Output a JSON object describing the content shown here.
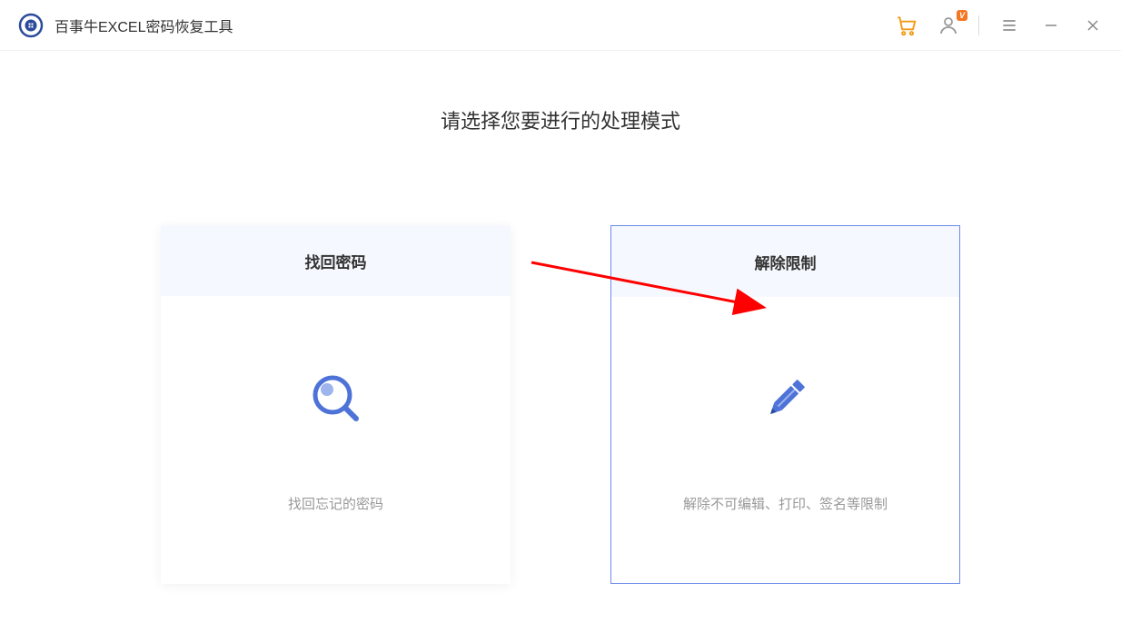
{
  "header": {
    "app_title": "百事牛EXCEL密码恢复工具",
    "profile_badge": "V"
  },
  "main": {
    "heading": "请选择您要进行的处理模式",
    "cards": [
      {
        "title": "找回密码",
        "desc": "找回忘记的密码",
        "selected": false
      },
      {
        "title": "解除限制",
        "desc": "解除不可编辑、打印、签名等限制",
        "selected": true
      }
    ]
  },
  "colors": {
    "accent_blue": "#4e73d8",
    "cart_orange": "#f49b1a",
    "badge_orange": "#f47621",
    "annotation_red": "#ff0000"
  }
}
